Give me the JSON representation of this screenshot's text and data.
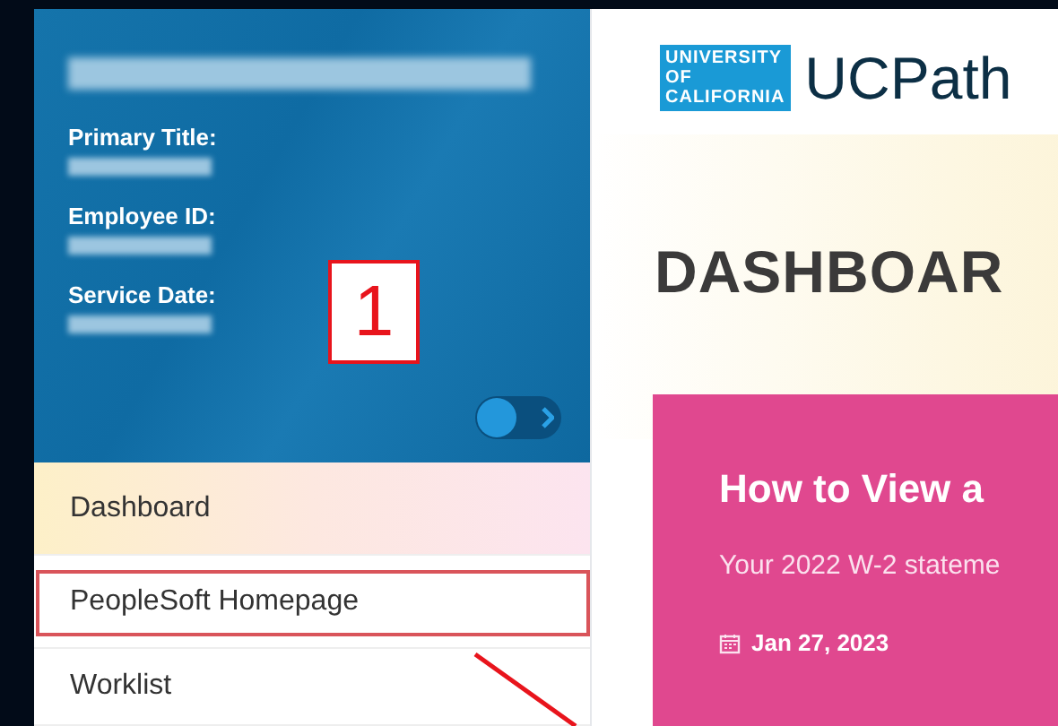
{
  "profile": {
    "fields": [
      {
        "label": "Primary Title:"
      },
      {
        "label": "Employee ID:"
      },
      {
        "label": "Service Date:"
      }
    ],
    "toggle": {
      "on": false
    }
  },
  "nav": [
    {
      "label": "Dashboard",
      "selected": true,
      "highlighted": false
    },
    {
      "label": "PeopleSoft Homepage",
      "selected": false,
      "highlighted": true
    },
    {
      "label": "Worklist",
      "selected": false,
      "highlighted": false
    }
  ],
  "logo": {
    "lines": [
      "UNIVERSITY",
      "OF",
      "CALIFORNIA"
    ],
    "name": "UCPath"
  },
  "heading": "DASHBOAR",
  "card": {
    "title": "How to View a",
    "text": "Your 2022 W-2 stateme",
    "date": "Jan 27, 2023"
  },
  "annotation": {
    "number": "1"
  }
}
